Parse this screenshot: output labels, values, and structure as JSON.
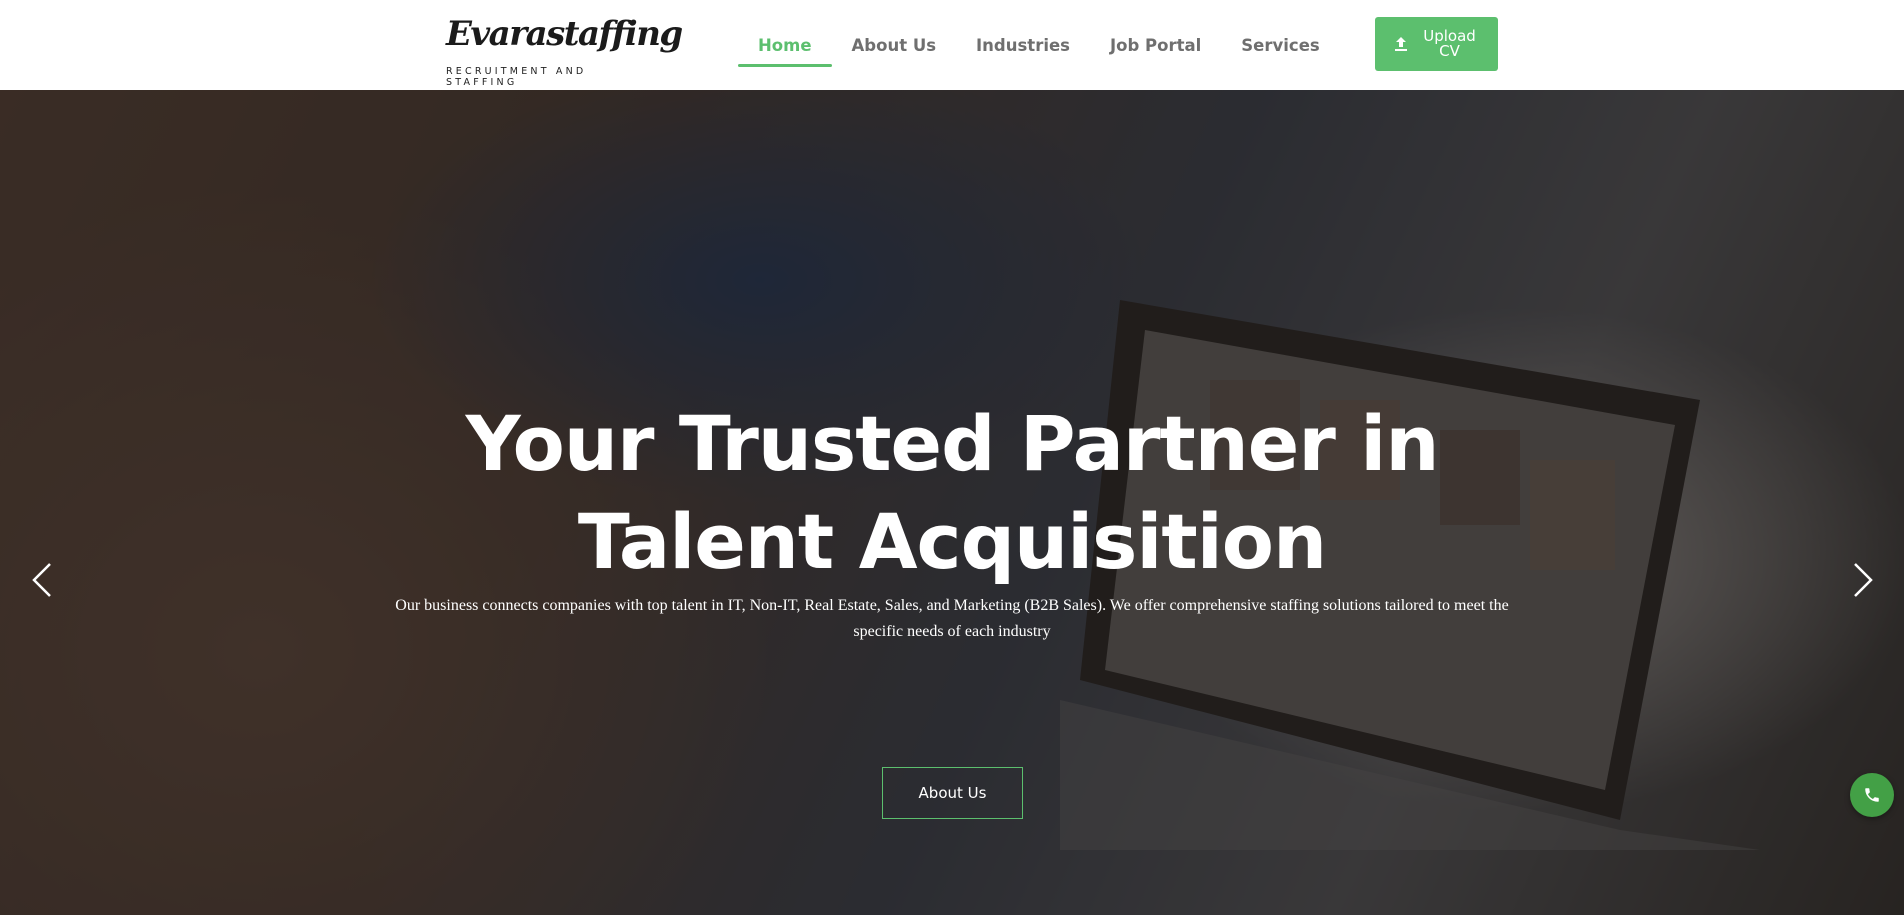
{
  "brand": {
    "name": "Evarastaffing",
    "tagline": "RECRUITMENT AND STAFFING"
  },
  "nav": {
    "items": [
      {
        "label": "Home",
        "active": true
      },
      {
        "label": "About Us",
        "active": false
      },
      {
        "label": "Industries",
        "active": false
      },
      {
        "label": "Job Portal",
        "active": false
      },
      {
        "label": "Services",
        "active": false
      }
    ],
    "upload_label": "Upload CV",
    "upload_icon": "upload-icon"
  },
  "hero": {
    "title": "Your Trusted Partner in Talent Acquisition",
    "subtitle": "Our business connects companies with top talent in IT, Non-IT, Real Estate, Sales, and Marketing (B2B Sales). We offer comprehensive staffing solutions tailored to meet the specific needs of each industry",
    "cta_label": "About Us",
    "prev_icon": "chevron-left-icon",
    "next_icon": "chevron-right-icon",
    "call_icon": "phone-icon"
  },
  "colors": {
    "accent": "#5cbf6e",
    "call_button": "#43a046",
    "nav_text": "#6f6f6f"
  }
}
